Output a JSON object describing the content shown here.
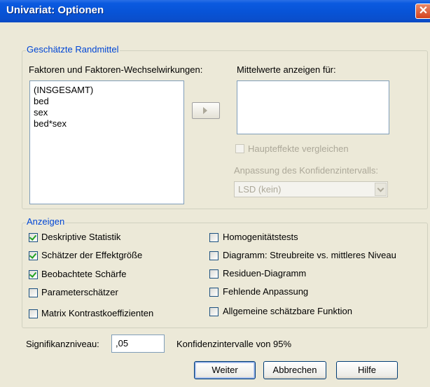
{
  "window": {
    "title": "Univariat: Optionen",
    "close_glyph": "✕",
    "close_icon": "close-icon"
  },
  "estimated_marginal_means": {
    "legend": "Geschätzte Randmittel",
    "factors_label": "Faktoren und Faktoren-Wechselwirkungen:",
    "factors": [
      "(INSGESAMT)",
      "bed",
      "sex",
      "bed*sex"
    ],
    "display_means_label": "Mittelwerte anzeigen für:",
    "move_icon": "right-arrow-icon",
    "compare_main_effects": {
      "label": "Haupteffekte vergleichen",
      "checked": false,
      "enabled": false
    },
    "ci_adjustment_label": "Anpassung des Konfidenzintervalls:",
    "ci_adjustment_value": "LSD (kein)"
  },
  "display": {
    "legend": "Anzeigen",
    "left_options": [
      {
        "label": "Deskriptive Statistik",
        "checked": true
      },
      {
        "label": "Schätzer der Effektgröße",
        "checked": true
      },
      {
        "label": "Beobachtete Schärfe",
        "checked": true
      },
      {
        "label": "Parameterschätzer",
        "checked": false
      },
      {
        "label": "Matrix Kontrastkoeffizienten",
        "checked": false
      }
    ],
    "right_options": [
      {
        "label": "Homogenitätstests",
        "checked": false
      },
      {
        "label": "Diagramm: Streubreite vs. mittleres Niveau",
        "checked": false
      },
      {
        "label": "Residuen-Diagramm",
        "checked": false
      },
      {
        "label": "Fehlende Anpassung",
        "checked": false
      },
      {
        "label": "Allgemeine schätzbare Funktion",
        "checked": false
      }
    ]
  },
  "significance": {
    "label": "Signifikanzniveau:",
    "value": ",05",
    "ci_text": "Konfidenzintervalle von 95%"
  },
  "buttons": {
    "continue": "Weiter",
    "cancel": "Abbrechen",
    "help": "Hilfe"
  }
}
